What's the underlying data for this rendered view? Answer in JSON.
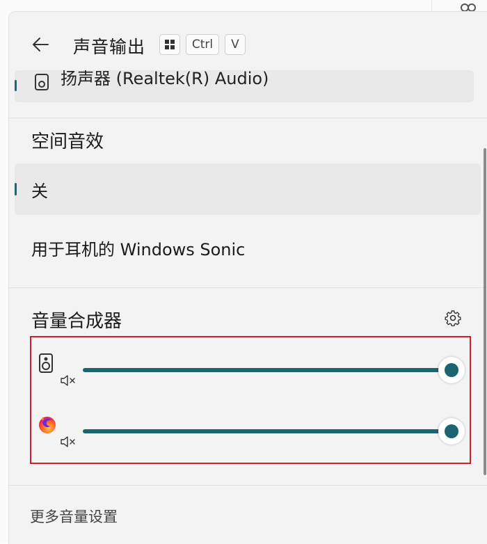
{
  "header": {
    "title": "声音输出",
    "shortcut_keys": [
      "",
      "Ctrl",
      "V"
    ]
  },
  "device": {
    "label": "扬声器 (Realtek(R) Audio)"
  },
  "spatial": {
    "title": "空间音效",
    "options": [
      {
        "label": "关",
        "selected": true
      },
      {
        "label": "用于耳机的 Windows Sonic",
        "selected": false
      }
    ]
  },
  "mixer": {
    "title": "音量合成器",
    "apps": [
      {
        "icon": "speaker-icon",
        "volume_fraction": 1.0
      },
      {
        "icon": "firefox-icon",
        "volume_fraction": 1.0
      }
    ]
  },
  "footer": {
    "more_settings_label": "更多音量设置"
  },
  "colors": {
    "accent": "#1a6570",
    "highlight_box": "#d0202a"
  }
}
